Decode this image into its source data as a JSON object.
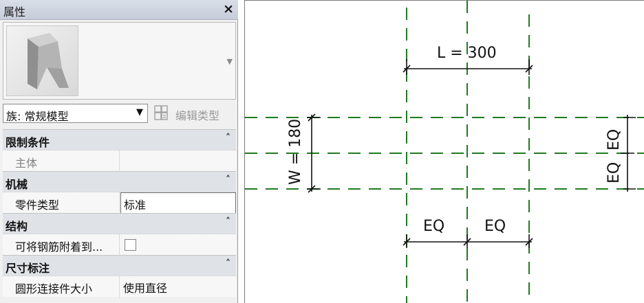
{
  "panel": {
    "title": "属性",
    "close_glyph": "×",
    "preview_icon": "family-type-preview-icon",
    "family_selector": "族: 常规模型",
    "edit_type_label": "编辑类型",
    "groups": [
      {
        "label": "限制条件",
        "collapse_glyph": "˄",
        "rows": [
          {
            "name": "主体",
            "value": ""
          }
        ]
      },
      {
        "label": "机械",
        "collapse_glyph": "˄",
        "rows": [
          {
            "name": "零件类型",
            "value": "标准"
          }
        ]
      },
      {
        "label": "结构",
        "collapse_glyph": "˄",
        "rows": [
          {
            "name": "可将钢筋附着到...",
            "checked": false
          }
        ]
      },
      {
        "label": "尺寸标注",
        "collapse_glyph": "˄",
        "rows": [
          {
            "name": "圆形连接件大小",
            "value": "使用直径"
          }
        ]
      }
    ]
  },
  "drawing": {
    "length_dim": "L = 300",
    "width_dim": "W = 180",
    "eq_left": "EQ",
    "eq_right": "EQ",
    "eq_vertical_top": "EQ",
    "eq_vertical_bottom": "EQ",
    "ref_plane_color": "#1f7a1f"
  }
}
